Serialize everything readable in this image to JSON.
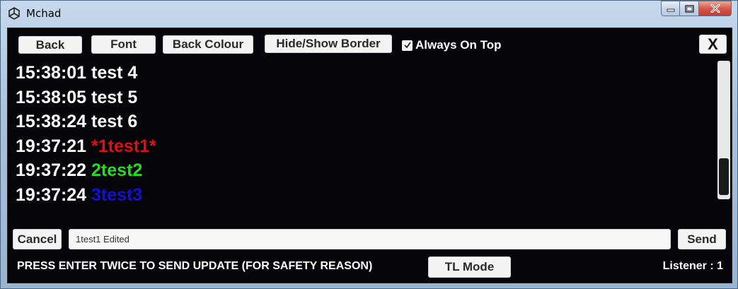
{
  "window": {
    "title": "Mchad",
    "icon": "unity-icon"
  },
  "toolbar": {
    "back_label": "Back",
    "font_label": "Font",
    "back_colour_label": "Back Colour",
    "hide_show_border_label": "Hide/Show Border",
    "always_on_top_label": "Always On Top",
    "always_on_top_checked": true,
    "close_label": "X"
  },
  "log": [
    {
      "time": "15:38:01",
      "text": "test 4",
      "color": "#ffffff"
    },
    {
      "time": "15:38:05",
      "text": "test 5",
      "color": "#ffffff"
    },
    {
      "time": "15:38:24",
      "text": "test 6",
      "color": "#ffffff"
    },
    {
      "time": "19:37:21",
      "text": "*1test1*",
      "color": "#e01010"
    },
    {
      "time": "19:37:22",
      "text": "2test2",
      "color": "#22dd22"
    },
    {
      "time": "19:37:24",
      "text": "3test3",
      "color": "#1010d8"
    }
  ],
  "input_row": {
    "cancel_label": "Cancel",
    "message_value": "1test1 Edited",
    "send_label": "Send"
  },
  "footer": {
    "notice": "PRESS ENTER TWICE TO SEND UPDATE (FOR SAFETY REASON)",
    "tl_mode_label": "TL Mode",
    "listener": "Listener : 1"
  }
}
